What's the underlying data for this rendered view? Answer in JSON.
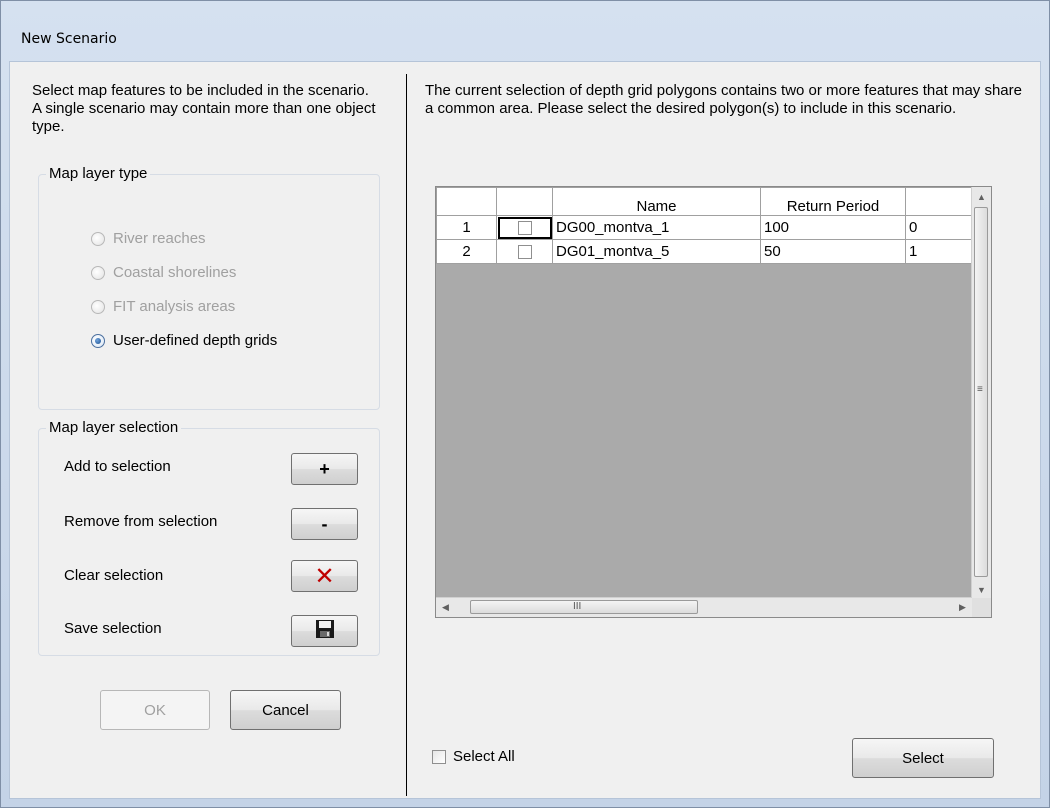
{
  "window": {
    "title": "New Scenario"
  },
  "left": {
    "intro": "Select map features to be included in the scenario.  A single scenario may contain more than one object type.",
    "layer_type_group": {
      "label": "Map layer type",
      "options": [
        {
          "label": "River reaches",
          "enabled": false,
          "checked": false
        },
        {
          "label": "Coastal shorelines",
          "enabled": false,
          "checked": false
        },
        {
          "label": "FIT analysis areas",
          "enabled": false,
          "checked": false
        },
        {
          "label": "User-defined depth grids",
          "enabled": true,
          "checked": true
        }
      ]
    },
    "selection_group": {
      "label": "Map layer selection",
      "rows": [
        {
          "label": "Add to selection",
          "icon": "plus-icon",
          "symbol": "+"
        },
        {
          "label": "Remove from selection",
          "icon": "minus-icon",
          "symbol": "-"
        },
        {
          "label": "Clear selection",
          "icon": "red-x-icon",
          "symbol": "✕"
        },
        {
          "label": "Save selection",
          "icon": "floppy-disk-icon",
          "symbol": ""
        }
      ]
    },
    "ok_label": "OK",
    "cancel_label": "Cancel"
  },
  "right": {
    "intro": "The current selection of depth grid polygons contains two or more features that may share a common area.  Please select the desired polygon(s) to include in this scenario.",
    "grid": {
      "columns": [
        "",
        "",
        "Name",
        "Return Period",
        ""
      ],
      "rows": [
        {
          "num": "1",
          "checked": false,
          "name": "DG00_montva_1",
          "return_period": "100",
          "extra": "0"
        },
        {
          "num": "2",
          "checked": false,
          "name": "DG01_montva_5",
          "return_period": "50",
          "extra": "1"
        }
      ],
      "hscroll_grip": "III",
      "vscroll_grip": "≡"
    },
    "select_all_label": "Select All",
    "select_label": "Select"
  }
}
